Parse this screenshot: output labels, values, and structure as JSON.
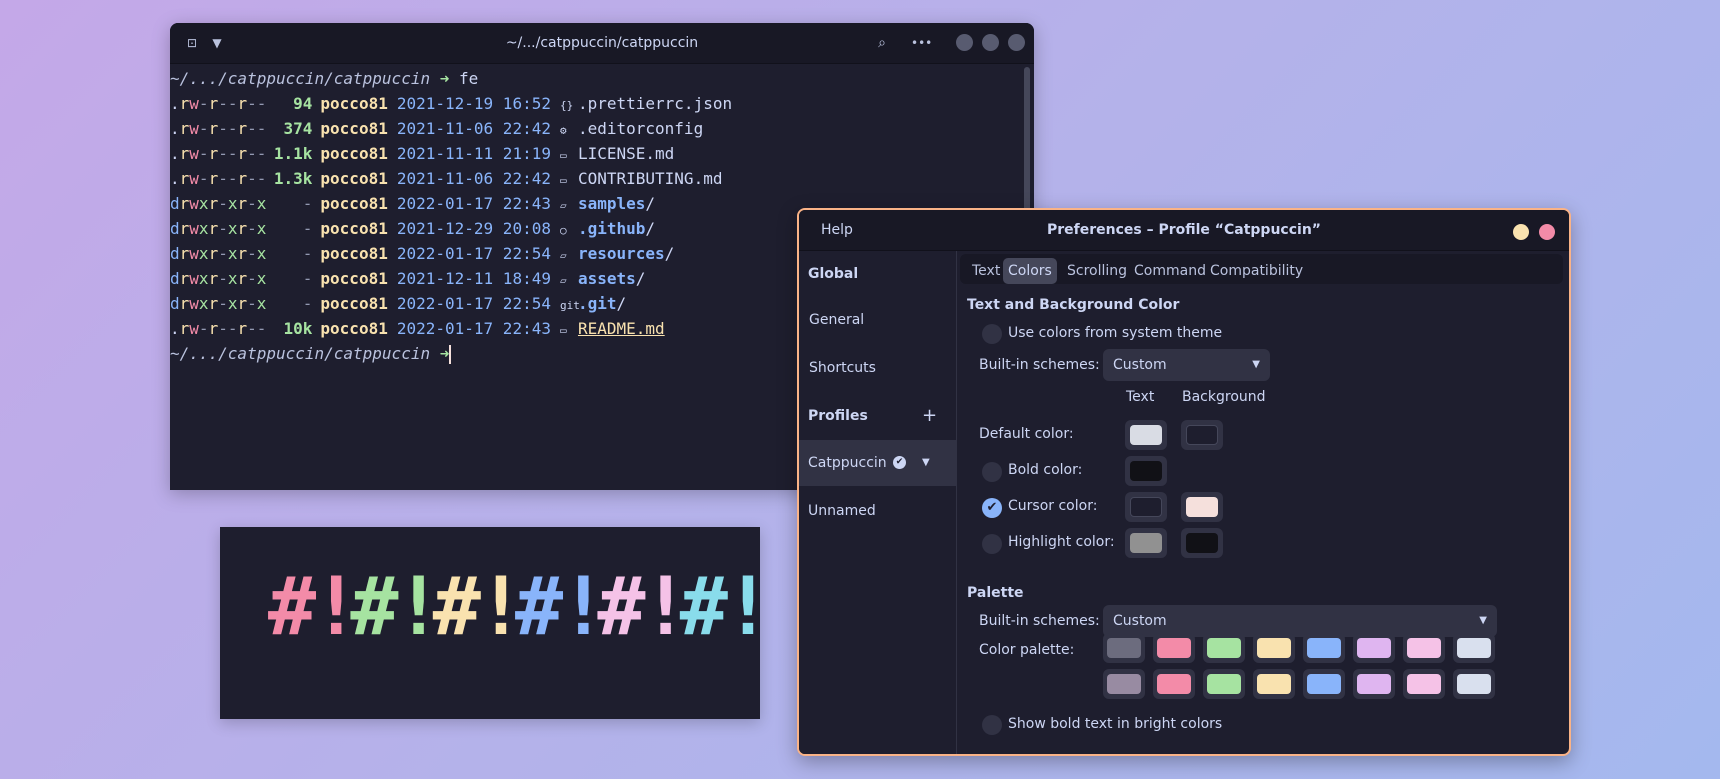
{
  "terminal": {
    "title": "~/.../catppuccin/catppuccin",
    "prompt_path": "~/.../catppuccin/catppuccin",
    "prompt_arrow": "➜",
    "command": "fe",
    "files": [
      {
        "perm": ".rw-r--r--",
        "size": "94",
        "user": "pocco81",
        "date": "2021-12-19 16:52",
        "icon": "{}",
        "name": ".prettierrc.json",
        "kind": "file"
      },
      {
        "perm": ".rw-r--r--",
        "size": "374",
        "user": "pocco81",
        "date": "2021-11-06 22:42",
        "icon": "⚙",
        "name": ".editorconfig",
        "kind": "file"
      },
      {
        "perm": ".rw-r--r--",
        "size": "1.1k",
        "user": "pocco81",
        "date": "2021-11-11 21:19",
        "icon": "▭",
        "name": "LICENSE.md",
        "kind": "file"
      },
      {
        "perm": ".rw-r--r--",
        "size": "1.3k",
        "user": "pocco81",
        "date": "2021-11-06 22:42",
        "icon": "▭",
        "name": "CONTRIBUTING.md",
        "kind": "file"
      },
      {
        "perm": "drwxr-xr-x",
        "size": "-",
        "user": "pocco81",
        "date": "2022-01-17 22:43",
        "icon": "▱",
        "name": "samples",
        "kind": "dir"
      },
      {
        "perm": "drwxr-xr-x",
        "size": "-",
        "user": "pocco81",
        "date": "2021-12-29 20:08",
        "icon": "○",
        "name": ".github",
        "kind": "dir"
      },
      {
        "perm": "drwxr-xr-x",
        "size": "-",
        "user": "pocco81",
        "date": "2022-01-17 22:54",
        "icon": "▱",
        "name": "resources",
        "kind": "dir"
      },
      {
        "perm": "drwxr-xr-x",
        "size": "-",
        "user": "pocco81",
        "date": "2021-12-11 18:49",
        "icon": "▱",
        "name": "assets",
        "kind": "dir"
      },
      {
        "perm": "drwxr-xr-x",
        "size": "-",
        "user": "pocco81",
        "date": "2022-01-17 22:54",
        "icon": "git",
        "name": ".git",
        "kind": "dir"
      },
      {
        "perm": ".rw-r--r--",
        "size": "10k",
        "user": "pocco81",
        "date": "2022-01-17 22:43",
        "icon": "▭",
        "name": "README.md",
        "kind": "readme"
      }
    ]
  },
  "logo": {
    "glyphs": [
      {
        "text": "#",
        "color": "#f38ba8"
      },
      {
        "text": "!",
        "color": "#f38ba8"
      },
      {
        "text": "#",
        "color": "#a6e3a1"
      },
      {
        "text": "!",
        "color": "#a6e3a1"
      },
      {
        "text": "#",
        "color": "#f9e2af"
      },
      {
        "text": "!",
        "color": "#f9e2af"
      },
      {
        "text": "#",
        "color": "#89b4fa"
      },
      {
        "text": "!",
        "color": "#89b4fa"
      },
      {
        "text": "#",
        "color": "#f5c2e7"
      },
      {
        "text": "!",
        "color": "#f5c2e7"
      },
      {
        "text": "#",
        "color": "#89dceb"
      },
      {
        "text": "!",
        "color": "#89dceb"
      }
    ]
  },
  "prefs": {
    "help": "Help",
    "title": "Preferences – Profile “Catppuccin”",
    "sidebar": {
      "global": "Global",
      "general": "General",
      "shortcuts": "Shortcuts",
      "profiles": "Profiles",
      "add": "+",
      "profile_selected": "Catppuccin",
      "profile_other": "Unnamed"
    },
    "tabs": [
      "Text",
      "Colors",
      "Scrolling",
      "Command",
      "Compatibility"
    ],
    "text_bg_title": "Text and Background Color",
    "use_system": "Use colors from system theme",
    "builtin_label": "Built-in schemes:",
    "builtin_value": "Custom",
    "col_text": "Text",
    "col_background": "Background",
    "default_color": "Default color:",
    "bold_color": "Bold color:",
    "cursor_color": "Cursor color:",
    "highlight_color": "Highlight color:",
    "palette_title": "Palette",
    "palette_builtin_label": "Built-in schemes:",
    "palette_builtin_value": "Custom",
    "color_palette": "Color palette:",
    "show_bold": "Show bold text in bright colors",
    "colors": {
      "default_text": "#d9dce4",
      "default_bg": "#1e1e2e",
      "bold_text": "#111116",
      "cursor_text": "#1e1e2e",
      "cursor_bg": "#f5e0dc",
      "highlight_text": "#919191",
      "highlight_bg": "#111116"
    },
    "palette_row1": [
      "#6c6c7e",
      "#f38ba8",
      "#a6e3a1",
      "#f9e2af",
      "#89b4fa",
      "#dfb5f0",
      "#f5c2e7",
      "#d9e0ee"
    ],
    "palette_row2": [
      "#988ba2",
      "#f38ba8",
      "#a6e3a1",
      "#f9e2af",
      "#89b4fa",
      "#dfb5f0",
      "#f5c2e7",
      "#d9e0ee"
    ]
  }
}
